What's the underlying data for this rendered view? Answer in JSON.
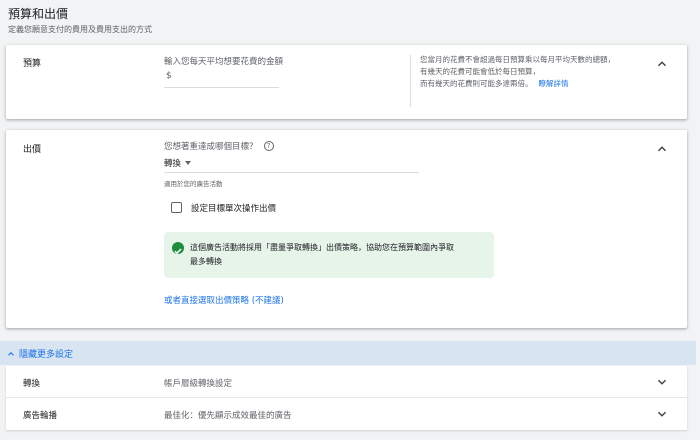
{
  "section": {
    "title": "預算和出價",
    "subtitle": "定義您願意支付的費用及費用支出的方式"
  },
  "budget": {
    "label": "預算",
    "placeholder": "輸入您每天平均想要花費的金額",
    "currency": "$",
    "hint_line1": "您當月的花費不會超過每日預算乘以每月平均天數的總額，",
    "hint_line2": "有幾天的花費可能會低於每日預算，",
    "hint_line3": "而有幾天的花費則可能多達兩倍。",
    "learn_more": "瞭解詳情"
  },
  "bidding": {
    "label": "出價",
    "question": "您想著重達成哪個目標？",
    "help_glyph": "?",
    "selected_goal": "轉換",
    "applies_note": "適用於您的廣告活動",
    "checkbox_label": "設定目標單次操作出價",
    "info_line1": "這個廣告活動將採用「盡量爭取轉換」出價策略，協助您在預算範圍內爭取",
    "info_line2": "最多轉換",
    "direct_link": "或者直接選取出價策略 (不建議)"
  },
  "more_settings": {
    "label": "隱藏更多設定"
  },
  "rows": [
    {
      "label": "轉換",
      "value": "帳戶層級轉換設定"
    },
    {
      "label": "廣告輪播",
      "value": "最佳化：優先顯示成效最佳的廣告"
    }
  ],
  "colors": {
    "accent": "#1a73e8",
    "success": "#1e8e3e",
    "success_bg": "#e6f4ea",
    "more_bar_bg": "#d9e4f2"
  }
}
